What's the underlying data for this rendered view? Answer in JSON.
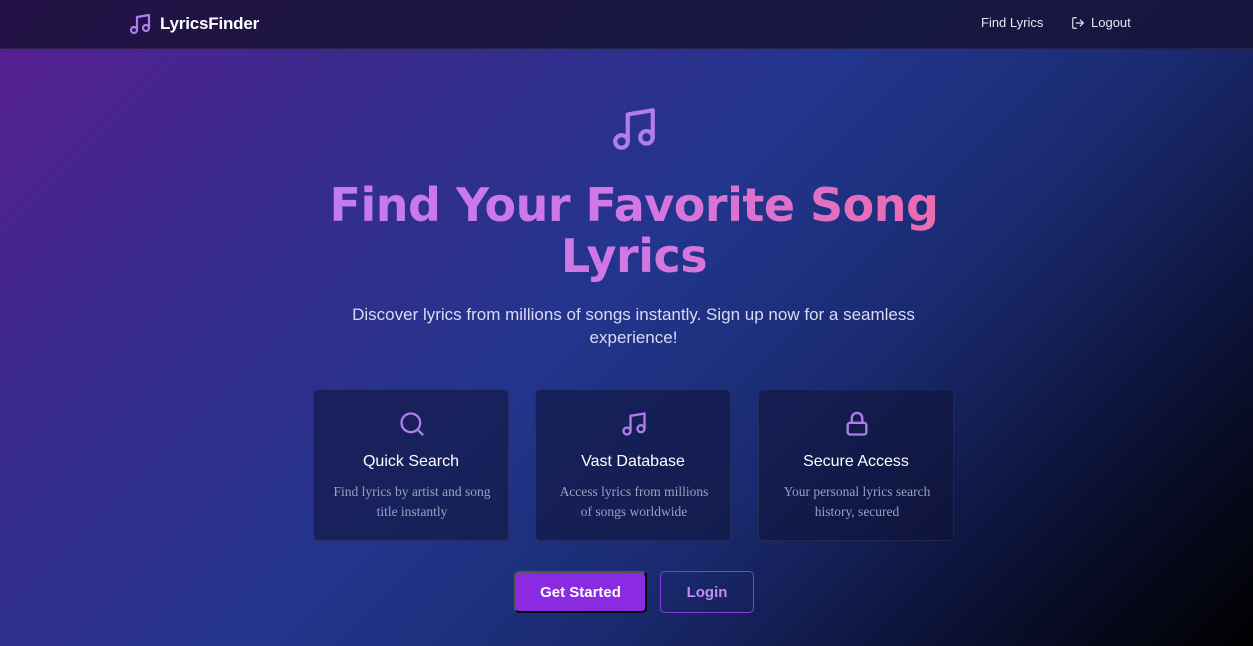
{
  "colors": {
    "accent": "#8a2be2",
    "accent_light": "#c38cf3",
    "icon": "#b07cf0",
    "gradient_title_start": "#c27af2",
    "gradient_title_end": "#ee6aa8"
  },
  "nav": {
    "brand_icon": "music-note-icon",
    "brand": "LyricsFinder",
    "links": [
      {
        "label": "Find Lyrics"
      },
      {
        "label": "Logout",
        "icon": "logout-icon"
      }
    ]
  },
  "hero": {
    "icon": "music-note-icon",
    "title": "Find Your Favorite Song Lyrics",
    "subtitle": "Discover lyrics from millions of songs instantly. Sign up now for a seamless experience!"
  },
  "features": [
    {
      "icon": "search-icon",
      "title": "Quick Search",
      "description": "Find lyrics by artist and song title instantly"
    },
    {
      "icon": "music-note-icon",
      "title": "Vast Database",
      "description": "Access lyrics from millions of songs worldwide"
    },
    {
      "icon": "lock-icon",
      "title": "Secure Access",
      "description": "Your personal lyrics search history, secured"
    }
  ],
  "actions": {
    "primary": "Get Started",
    "secondary": "Login"
  }
}
